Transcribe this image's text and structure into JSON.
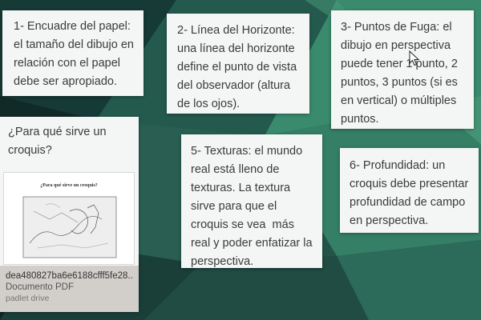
{
  "colors": {
    "background_dark": "#12302c",
    "background_mid": "#2f6b5c",
    "background_light": "#3f8f74",
    "card": "#f4f6f5",
    "attachment_footer": "#d2cfcb"
  },
  "cards": {
    "c1": {
      "text": "1- Encuadre del papel: el tamaño del dibujo en relación con el papel debe ser apropiado."
    },
    "c2": {
      "text": "2- Línea del Horizonte: una línea del horizonte define el punto de vista del observador (altura de los ojos)."
    },
    "c3": {
      "text": "3- Puntos de Fuga: el dibujo en perspectiva puede tener 1 punto, 2 puntos, 3 puntos (si es en vertical) o múltiples puntos."
    },
    "c4": {
      "title": "¿Para qué sirve un croquis?",
      "attachment": {
        "preview_heading": "¿Para qué sirve un croquis?",
        "filename": "dea480827ba6e6188cfff5fe28...",
        "filetype": "Documento PDF",
        "source": "padlet drive"
      }
    },
    "c5": {
      "text": "5- Texturas: el mundo real está lleno de texturas. La textura sirve para que el croquis se vea  más real y poder enfatizar la perspectiva."
    },
    "c6": {
      "text": "6- Profundidad: un croquis debe presentar profundidad de campo en perspectiva."
    }
  },
  "icons": {
    "cursor": "mouse-pointer-icon"
  }
}
